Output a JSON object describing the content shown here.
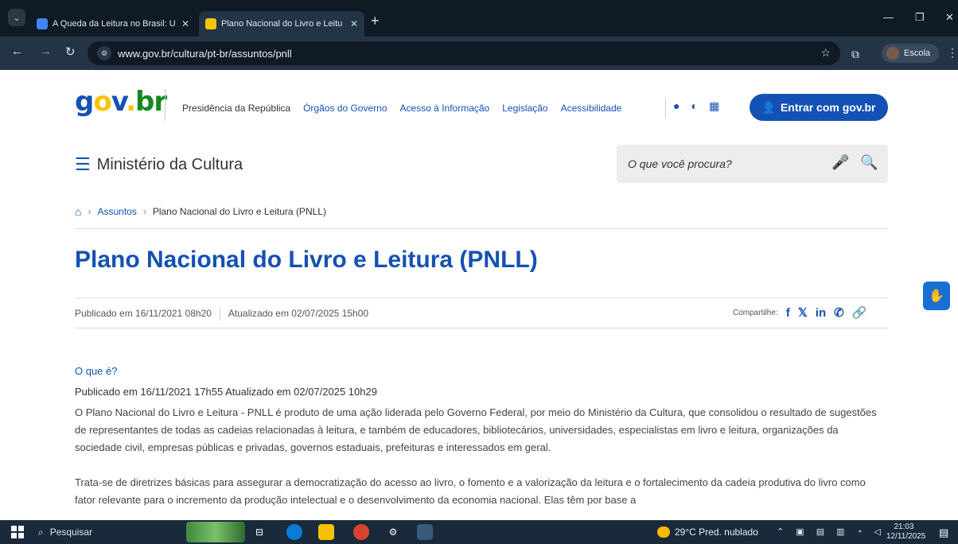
{
  "browser": {
    "tabs": [
      {
        "title": "A Queda da Leitura no Brasil: U"
      },
      {
        "title": "Plano Nacional do Livro e Leitu"
      }
    ],
    "url": "www.gov.br/cultura/pt-br/assuntos/pnll",
    "profile_label": "Escola"
  },
  "header": {
    "logo": {
      "g": "g",
      "o": "o",
      "v": "v",
      "dot": ".",
      "br": "br"
    },
    "links": [
      "Presidência da República",
      "Órgãos do Governo",
      "Acesso à Informação",
      "Legislação",
      "Acessibilidade"
    ],
    "login_button": "Entrar com gov.br",
    "ministry": "Ministério da Cultura",
    "search_placeholder": "O que você procura?"
  },
  "breadcrumb": {
    "items": [
      "Assuntos",
      "Plano Nacional do Livro e Leitura (PNLL)"
    ]
  },
  "article": {
    "title": "Plano Nacional do Livro e Leitura (PNLL)",
    "published": "Publicado em 16/11/2021 08h20",
    "updated": "Atualizado em 02/07/2025 15h00",
    "share_label": "Compartilhe:",
    "section_title": "O que é?",
    "section_meta": "Publicado em 16/11/2021 17h55 Atualizado em 02/07/2025 10h29",
    "paragraphs": [
      "O Plano Nacional do Livro e Leitura - PNLL é produto de uma ação liderada pelo Governo Federal, por meio do Ministério da Cultura, que consolidou o resultado de sugestões de representantes de todas as cadeias relacionadas à leitura, e também de educadores, bibliotecários, universidades, especialistas em livro e leitura, organizações da sociedade civil, empresas públicas e privadas, governos estaduais, prefeituras e interessados em geral.",
      "Trata-se de diretrizes básicas para assegurar a democratização do acesso ao livro, o fomento e a valorização da leitura e o fortalecimento da cadeia produtiva do livro como fator relevante para o incremento da produção intelectual e o desenvolvimento da economia nacional. Elas têm por base a"
    ]
  },
  "taskbar": {
    "search": "Pesquisar",
    "weather": "29°C  Pred. nublado",
    "time": "21:03",
    "date": "12/11/2025"
  },
  "colors": {
    "brand_blue": "#1351b4",
    "chrome_dark": "#0f1a24"
  }
}
